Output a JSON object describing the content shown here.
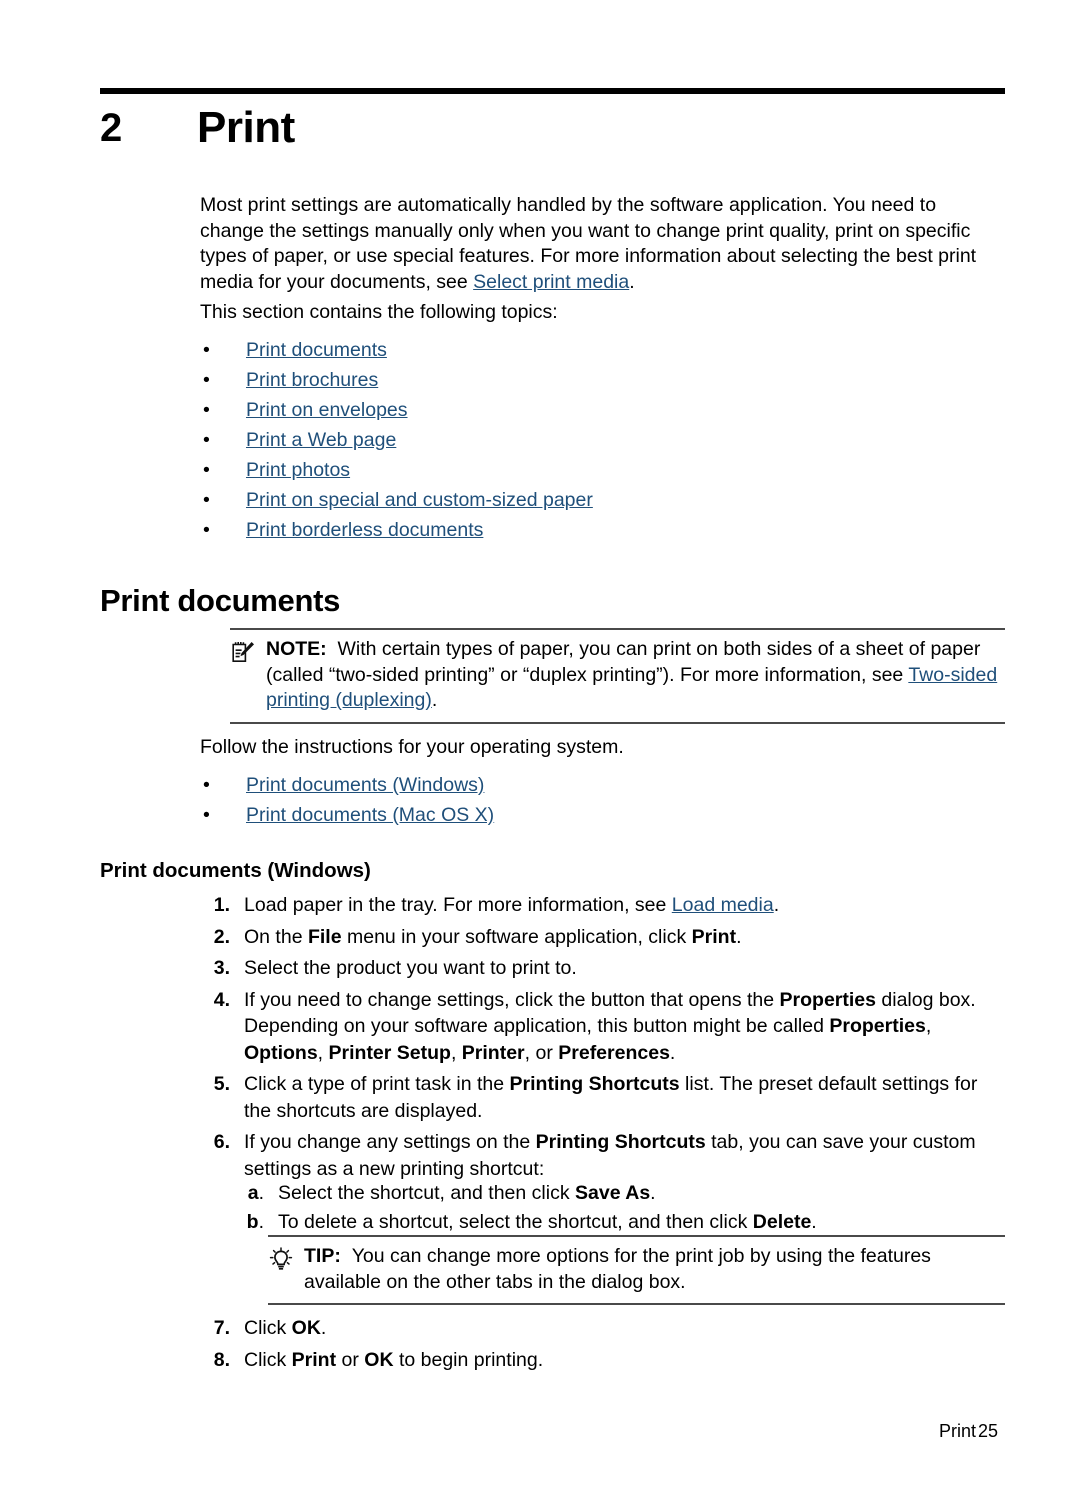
{
  "page": {
    "chapter_number": "2",
    "chapter_title": "Print"
  },
  "intro": {
    "paragraph_1_a": "Most print settings are automatically handled by the software application. You need to change the settings manually only when you want to change print quality, print on specific types of paper, or use special features. For more information about selecting the best print media for your documents, see ",
    "paragraph_1_link": "Select print media",
    "paragraph_1_b": ".",
    "paragraph_2": "This section contains the following topics:"
  },
  "topics": {
    "bullet": "•",
    "items": [
      "Print documents",
      "Print brochures",
      "Print on envelopes",
      "Print a Web page",
      "Print photos",
      "Print on special and custom-sized paper",
      "Print borderless documents"
    ]
  },
  "section": {
    "heading": "Print documents"
  },
  "note": {
    "icon": "note-pad-icon",
    "label": "NOTE:",
    "text_a": "With certain types of paper, you can print on both sides of a sheet of paper (called “two-sided printing” or “duplex printing”). For more information, see ",
    "link": "Two-sided printing (duplexing)",
    "text_b": "."
  },
  "follow": {
    "paragraph": "Follow the instructions for your operating system.",
    "bullet": "•",
    "items": [
      "Print documents (Windows)",
      "Print documents (Mac OS X)"
    ]
  },
  "windows": {
    "heading": "Print documents (Windows)",
    "steps": [
      {
        "num": "1.",
        "parts": [
          {
            "t": "plain",
            "v": "Load paper in the tray. For more information, see "
          },
          {
            "t": "link",
            "v": "Load media"
          },
          {
            "t": "plain",
            "v": "."
          }
        ]
      },
      {
        "num": "2.",
        "parts": [
          {
            "t": "plain",
            "v": "On the "
          },
          {
            "t": "bold",
            "v": "File"
          },
          {
            "t": "plain",
            "v": " menu in your software application, click "
          },
          {
            "t": "bold",
            "v": "Print"
          },
          {
            "t": "plain",
            "v": "."
          }
        ]
      },
      {
        "num": "3.",
        "parts": [
          {
            "t": "plain",
            "v": "Select the product you want to print to."
          }
        ]
      },
      {
        "num": "4.",
        "parts": [
          {
            "t": "plain",
            "v": "If you need to change settings, click the button that opens the "
          },
          {
            "t": "bold",
            "v": "Properties"
          },
          {
            "t": "plain",
            "v": " dialog box. Depending on your software application, this button might be called "
          },
          {
            "t": "bold",
            "v": "Properties"
          },
          {
            "t": "plain",
            "v": ", "
          },
          {
            "t": "bold",
            "v": "Options"
          },
          {
            "t": "plain",
            "v": ", "
          },
          {
            "t": "bold",
            "v": "Printer Setup"
          },
          {
            "t": "plain",
            "v": ", "
          },
          {
            "t": "bold",
            "v": "Printer"
          },
          {
            "t": "plain",
            "v": ", or "
          },
          {
            "t": "bold",
            "v": "Preferences"
          },
          {
            "t": "plain",
            "v": "."
          }
        ]
      },
      {
        "num": "5.",
        "parts": [
          {
            "t": "plain",
            "v": "Click a type of print task in the "
          },
          {
            "t": "bold",
            "v": "Printing Shortcuts"
          },
          {
            "t": "plain",
            "v": " list. The preset default settings for the shortcuts are displayed."
          }
        ]
      },
      {
        "num": "6.",
        "parts": [
          {
            "t": "plain",
            "v": "If you change any settings on the "
          },
          {
            "t": "bold",
            "v": "Printing Shortcuts"
          },
          {
            "t": "plain",
            "v": " tab, you can save your custom settings as a new printing shortcut:"
          }
        ]
      }
    ],
    "substeps": [
      {
        "num": "a",
        "num_suffix": ".",
        "parts": [
          {
            "t": "plain",
            "v": "Select the shortcut, and then click "
          },
          {
            "t": "bold",
            "v": "Save As"
          },
          {
            "t": "plain",
            "v": "."
          }
        ]
      },
      {
        "num": "b",
        "num_suffix": ".",
        "parts": [
          {
            "t": "plain",
            "v": "To delete a shortcut, select the shortcut, and then click "
          },
          {
            "t": "bold",
            "v": "Delete"
          },
          {
            "t": "plain",
            "v": "."
          }
        ]
      }
    ],
    "tip": {
      "icon": "light-bulb-icon",
      "label": "TIP:",
      "text": "You can change more options for the print job by using the features available on the other tabs in the dialog box."
    },
    "steps_tail": [
      {
        "num": "7.",
        "parts": [
          {
            "t": "plain",
            "v": "Click "
          },
          {
            "t": "bold",
            "v": "OK"
          },
          {
            "t": "plain",
            "v": "."
          }
        ]
      },
      {
        "num": "8.",
        "parts": [
          {
            "t": "plain",
            "v": "Click "
          },
          {
            "t": "bold",
            "v": "Print"
          },
          {
            "t": "plain",
            "v": " or "
          },
          {
            "t": "bold",
            "v": "OK"
          },
          {
            "t": "plain",
            "v": " to begin printing."
          }
        ]
      }
    ]
  },
  "footer": {
    "label": "Print",
    "page_number": "25"
  },
  "colors": {
    "link": "#1f4f7a",
    "text": "#000000",
    "rule": "#4a4a4a",
    "chapter_rule": "#000000"
  }
}
